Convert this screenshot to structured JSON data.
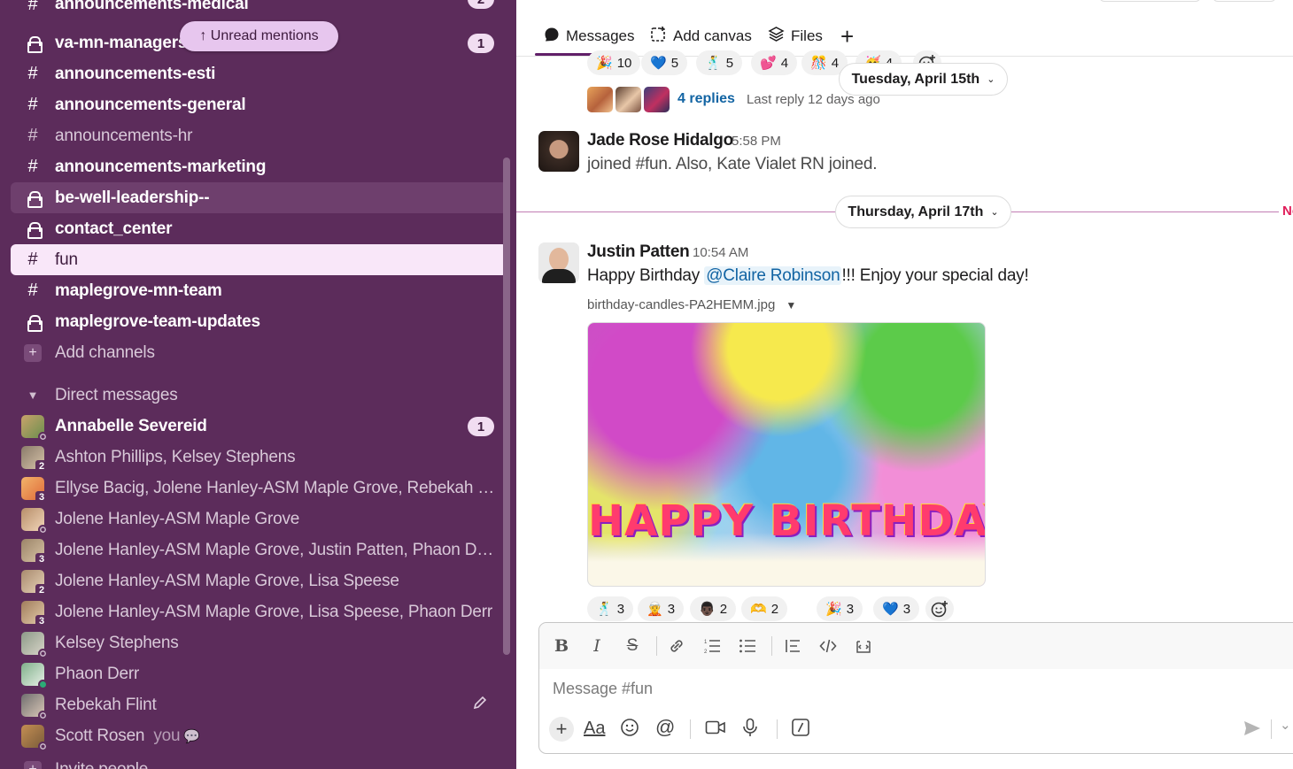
{
  "sidebar": {
    "unread_pill": "↑ Unread mentions",
    "cut_top_label": "announcements-medical",
    "channels": [
      {
        "label": "va-mn-managers",
        "icon": "lock-icon",
        "badge": "1",
        "bold": true
      },
      {
        "label": "announcements-esti",
        "icon": "hash-icon",
        "bold": true
      },
      {
        "label": "announcements-general",
        "icon": "hash-icon",
        "bold": true
      },
      {
        "label": "announcements-hr",
        "icon": "hash-icon",
        "bold": false
      },
      {
        "label": "announcements-marketing",
        "icon": "hash-icon",
        "bold": true
      },
      {
        "label": "be-well-leadership--",
        "icon": "lock-icon",
        "bold": true
      },
      {
        "label": "contact_center",
        "icon": "lock-icon",
        "bold": true
      },
      {
        "label": "fun",
        "icon": "hash-icon",
        "bold": false,
        "active": true
      },
      {
        "label": "maplegrove-mn-team",
        "icon": "hash-icon",
        "bold": true
      },
      {
        "label": "maplegrove-team-updates",
        "icon": "lock-icon",
        "bold": true
      }
    ],
    "add_channels": "Add channels",
    "dm_header": "Direct messages",
    "dms": [
      {
        "label": "Annabelle Severeid",
        "badge": "1",
        "bold": true
      },
      {
        "label": "Ashton Phillips, Kelsey Stephens",
        "count": "2"
      },
      {
        "label": "Ellyse Bacig, Jolene Hanley-ASM Maple Grove, Rebekah Flint",
        "count": "3"
      },
      {
        "label": "Jolene Hanley-ASM Maple Grove"
      },
      {
        "label": "Jolene Hanley-ASM Maple Grove, Justin Patten, Phaon Derr",
        "count": "3"
      },
      {
        "label": "Jolene Hanley-ASM Maple Grove, Lisa Speese",
        "count": "2"
      },
      {
        "label": "Jolene Hanley-ASM Maple Grove, Lisa Speese, Phaon Derr",
        "count": "3"
      },
      {
        "label": "Kelsey Stephens"
      },
      {
        "label": "Phaon Derr",
        "online": true
      },
      {
        "label": "Rebekah Flint"
      },
      {
        "label": "Scott Rosen",
        "you": "you"
      }
    ],
    "invite_people": "Invite people"
  },
  "tabs": {
    "messages": "Messages",
    "add_canvas": "Add canvas",
    "files": "Files"
  },
  "thread": {
    "top_reactions": [
      {
        "emoji": "🎉",
        "count": "10"
      },
      {
        "emoji": "💙",
        "count": "5"
      },
      {
        "emoji": "🕺",
        "count": "5"
      },
      {
        "emoji": "💕",
        "count": "4"
      },
      {
        "emoji": "🎊",
        "count": "4"
      },
      {
        "emoji": "🥳",
        "count": "4"
      }
    ],
    "replies": "4 replies",
    "last_reply": "Last reply 12 days ago",
    "date1": "Tuesday, April 15th",
    "date2": "Thursday, April 17th",
    "new_marker": "New",
    "msg1": {
      "sender": "Jade Rose Hidalgo",
      "time": "5:58 PM",
      "text": "joined #fun. Also, Kate Vialet RN joined."
    },
    "msg2": {
      "sender": "Justin Patten",
      "time": "10:54 AM",
      "text_before": "Happy Birthday ",
      "mention": "@Claire Robinson",
      "text_after": "!!! Enjoy your special day!",
      "file_name": "birthday-candles-PA2HEMM.jpg",
      "image_text": "HAPPY BIRTHDAY",
      "reactions": [
        {
          "emoji": "🕺",
          "count": "3"
        },
        {
          "emoji": "🧝",
          "count": "3"
        },
        {
          "emoji": "👨🏿",
          "count": "2"
        },
        {
          "emoji": "🫶",
          "count": "2"
        },
        {
          "emoji": "🎉",
          "count": "3"
        },
        {
          "emoji": "💙",
          "count": "3"
        }
      ]
    }
  },
  "composer": {
    "placeholder": "Message #fun"
  }
}
